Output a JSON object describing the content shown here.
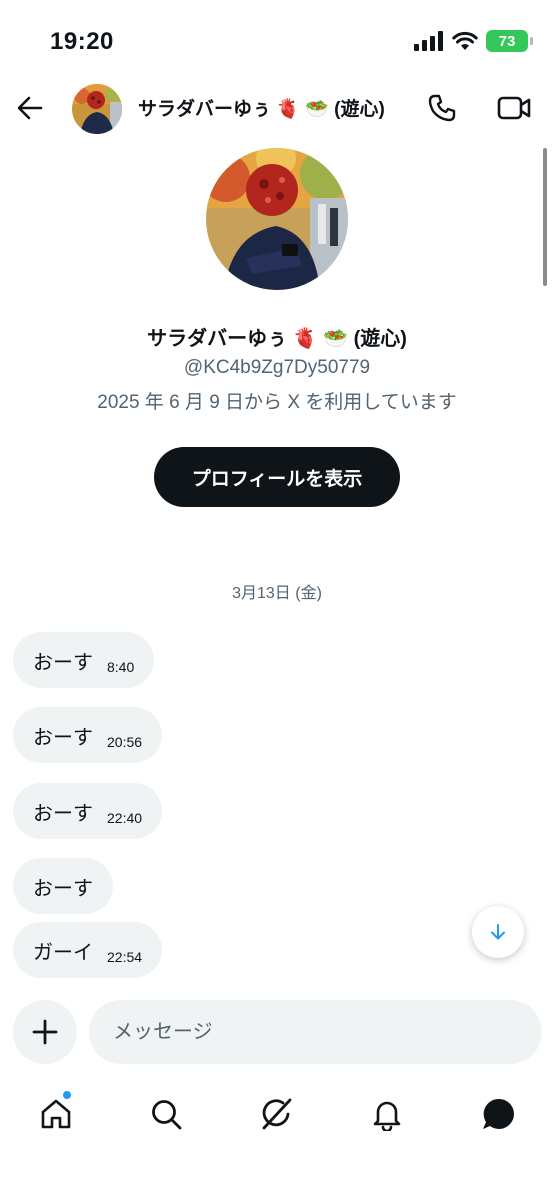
{
  "status_bar": {
    "time": "19:20",
    "battery": "73"
  },
  "header": {
    "name": "サラダバーゆぅ 🫀 🥗 (遊心)"
  },
  "profile": {
    "name": "サラダバーゆぅ 🫀 🥗 (遊心)",
    "handle": "@KC4b9Zg7Dy50779",
    "joined": "2025 年 6 月 9 日から X を利用しています",
    "view_profile_label": "プロフィールを表示"
  },
  "date_separator": "3月13日 (金)",
  "messages": [
    {
      "text": "おーす",
      "time": "8:40"
    },
    {
      "text": "おーす",
      "time": "20:56"
    },
    {
      "text": "おーす",
      "time": "22:40"
    },
    {
      "text": "おーす",
      "time": ""
    },
    {
      "text": "ガーイ",
      "time": "22:54"
    }
  ],
  "composer": {
    "placeholder": "メッセージ"
  },
  "icons": {
    "back": "arrow-left-icon",
    "call": "phone-icon",
    "video": "video-camera-icon",
    "scroll_down": "arrow-down-icon",
    "add": "plus-icon",
    "nav": [
      "home-icon",
      "search-icon",
      "grok-icon",
      "bell-icon",
      "messages-icon"
    ]
  },
  "colors": {
    "accent": "#1d9bf0",
    "bubble": "#eff3f4",
    "button_dark": "#0f1419",
    "battery": "#34c759",
    "secondary_text": "#536471"
  }
}
